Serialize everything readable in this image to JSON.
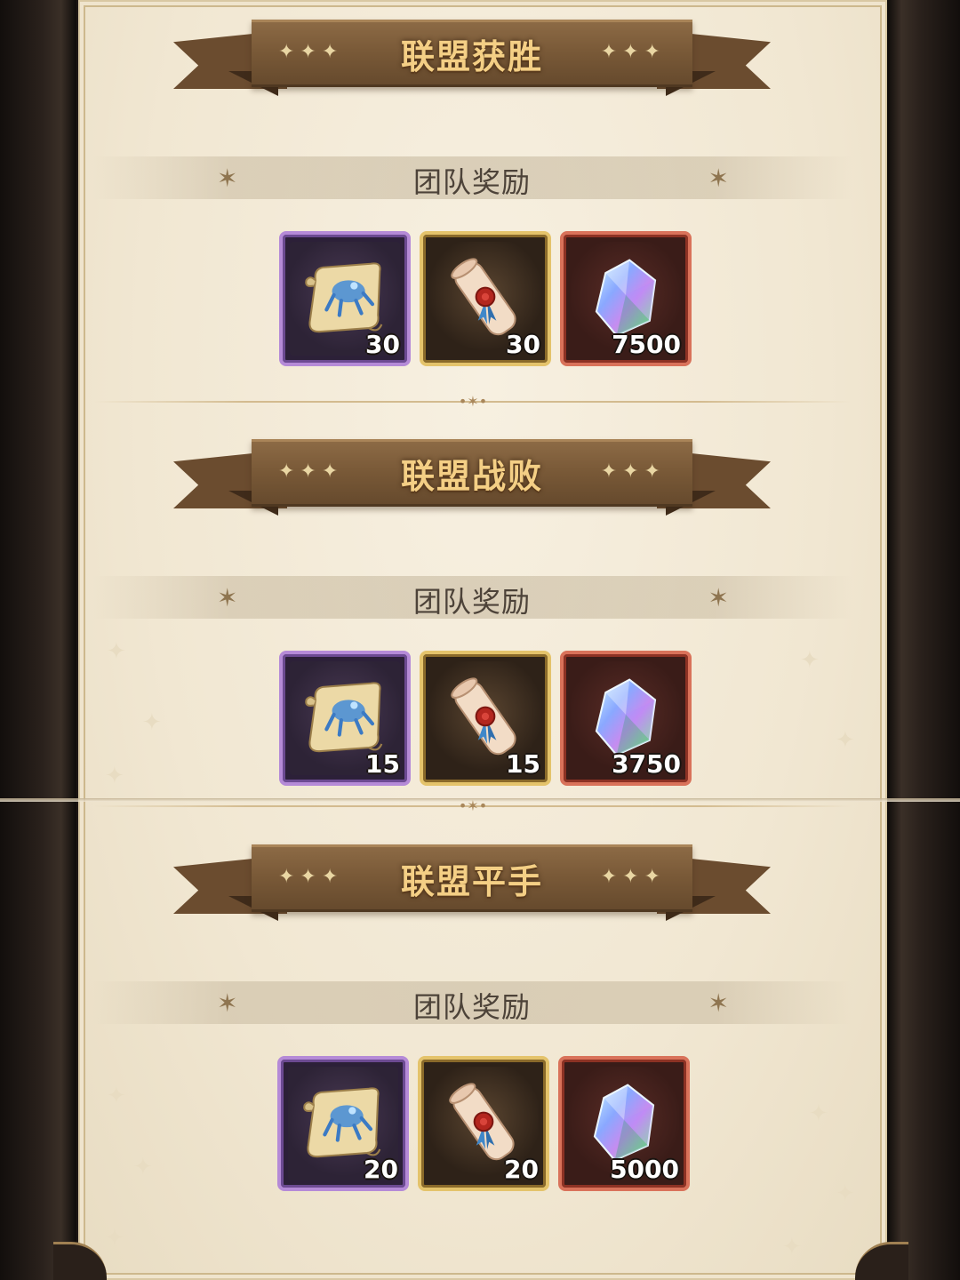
{
  "sections": [
    {
      "title": "联盟获胜",
      "subtitle": "团队奖励",
      "rewards": [
        {
          "icon": "blueprint-scroll-icon",
          "rarity": "purple",
          "count": "30"
        },
        {
          "icon": "sealed-letter-scroll-icon",
          "rarity": "gold",
          "count": "30"
        },
        {
          "icon": "prism-crystal-icon",
          "rarity": "red",
          "count": "7500"
        }
      ]
    },
    {
      "title": "联盟战败",
      "subtitle": "团队奖励",
      "rewards": [
        {
          "icon": "blueprint-scroll-icon",
          "rarity": "purple",
          "count": "15"
        },
        {
          "icon": "sealed-letter-scroll-icon",
          "rarity": "gold",
          "count": "15"
        },
        {
          "icon": "prism-crystal-icon",
          "rarity": "red",
          "count": "3750"
        }
      ]
    },
    {
      "title": "联盟平手",
      "subtitle": "团队奖励",
      "rewards": [
        {
          "icon": "blueprint-scroll-icon",
          "rarity": "purple",
          "count": "20"
        },
        {
          "icon": "sealed-letter-scroll-icon",
          "rarity": "gold",
          "count": "20"
        },
        {
          "icon": "prism-crystal-icon",
          "rarity": "red",
          "count": "5000"
        }
      ]
    }
  ],
  "colors": {
    "parchment": "#f1e7d2",
    "ribbon": "#7a5a38",
    "title_text": "#f4cf85",
    "purple_frame": "#b58ad7",
    "gold_frame": "#e4c36b",
    "red_frame": "#d9725a"
  }
}
